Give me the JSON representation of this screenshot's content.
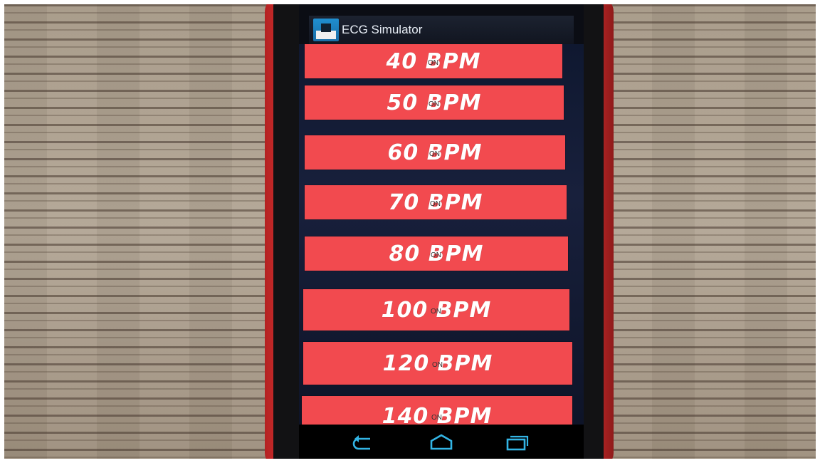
{
  "app": {
    "title": "ECG Simulator",
    "icon": "ecg-app-icon"
  },
  "rates": [
    {
      "label": "40 BPM",
      "state": "ON"
    },
    {
      "label": "50 BPM",
      "state": "ON"
    },
    {
      "label": "60 BPM",
      "state": "ON"
    },
    {
      "label": "70 BPM",
      "state": "ON"
    },
    {
      "label": "80 BPM",
      "state": "ON"
    },
    {
      "label": "100 BPM",
      "state": "ON"
    },
    {
      "label": "120 BPM",
      "state": "ON"
    },
    {
      "label": "140 BPM",
      "state": "ON"
    }
  ],
  "nav": {
    "back_icon": "back-icon",
    "home_icon": "home-icon",
    "recents_icon": "recents-icon"
  },
  "colors": {
    "button": "#f24a4f",
    "action_bar": "#151a26",
    "label": "#ffffff",
    "nav_icons": "#33b5e5"
  }
}
